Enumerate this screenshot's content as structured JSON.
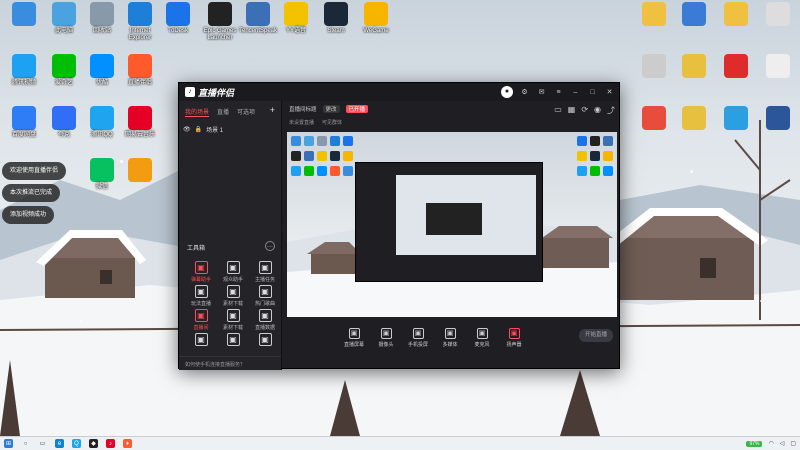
{
  "desktop_icons_left": [
    {
      "label": "",
      "icon": "user-folder-icon",
      "color": "#3a8dde"
    },
    {
      "label": "此电脑",
      "icon": "computer-icon",
      "color": "#4aa3df"
    },
    {
      "label": "回收站",
      "icon": "recycle-bin-icon",
      "color": "#8899aa"
    },
    {
      "label": "Internet Explorer",
      "icon": "ie-icon",
      "color": "#1e7fd8"
    },
    {
      "label": "ToDesk",
      "icon": "todesk-icon",
      "color": "#1a73e8"
    },
    {
      "label": "Epic Games Launcher",
      "icon": "epic-icon",
      "color": "#222222"
    },
    {
      "label": "TencentSpeak",
      "icon": "speak-icon",
      "color": "#3b6fb6"
    },
    {
      "label": "YY语音",
      "icon": "yy-icon",
      "color": "#f2c200"
    },
    {
      "label": "Steam",
      "icon": "steam-icon",
      "color": "#1b2838"
    },
    {
      "label": "WeGame",
      "icon": "wegame-icon",
      "color": "#f7b500"
    },
    {
      "label": "腾讯视频",
      "icon": "tencent-video-icon",
      "color": "#1da1f2"
    },
    {
      "label": "爱奇艺",
      "icon": "iqiyi-icon",
      "color": "#00be06"
    },
    {
      "label": "优酷",
      "icon": "youku-icon",
      "color": "#0090ff"
    },
    {
      "label": "直播伴侣",
      "icon": "companion-icon",
      "color": "#ff5a2b"
    },
    {
      "label": "百度网盘",
      "icon": "baidu-pan-icon",
      "color": "#2e7cf6"
    },
    {
      "label": "夸克",
      "icon": "quark-icon",
      "color": "#2f6ef5"
    },
    {
      "label": "腾讯QQ",
      "icon": "qq-icon",
      "color": "#1ea5f0"
    },
    {
      "label": "网易云音乐",
      "icon": "netease-music-icon",
      "color": "#e60026"
    },
    {
      "label": "微信",
      "icon": "wechat-icon",
      "color": "#07c160"
    },
    {
      "label": "",
      "icon": "game-icon",
      "color": "#f39c12"
    }
  ],
  "desktop_icons_right": [
    {
      "label": "",
      "icon": "folder-icon",
      "color": "#f0c040"
    },
    {
      "label": "",
      "icon": "folder-icon",
      "color": "#3a7bd5"
    },
    {
      "label": "",
      "icon": "folder-icon",
      "color": "#f0c040"
    },
    {
      "label": "",
      "icon": "doc-icon",
      "color": "#dddddd"
    },
    {
      "label": "",
      "icon": "doc-icon",
      "color": "#cccccc"
    },
    {
      "label": "",
      "icon": "folder-icon",
      "color": "#e8c040"
    },
    {
      "label": "",
      "icon": "app-icon",
      "color": "#e02b2b"
    },
    {
      "label": "",
      "icon": "doc-icon",
      "color": "#eeeeee"
    },
    {
      "label": "",
      "icon": "pdf-icon",
      "color": "#e84c3d"
    },
    {
      "label": "",
      "icon": "folder-icon",
      "color": "#e8c040"
    },
    {
      "label": "",
      "icon": "app-icon",
      "color": "#2aa0e0"
    },
    {
      "label": "",
      "icon": "word-icon",
      "color": "#2b579a"
    }
  ],
  "notifications": [
    "欢迎使用直播伴侣",
    "本次推流已完成",
    "添加视频成功"
  ],
  "app": {
    "brand": "直播伴侣",
    "version": "",
    "scene_tabs": [
      "我的场景",
      "直播",
      "可选项"
    ],
    "scene_item": "场景 1",
    "tools_title": "工具箱",
    "tools": [
      {
        "label": "弹幕助手",
        "icon": "barrage-icon",
        "red": true
      },
      {
        "label": "观众助手",
        "icon": "audience-icon",
        "red": false
      },
      {
        "label": "主播任务",
        "icon": "task-icon",
        "red": false
      },
      {
        "label": "玩法直播",
        "icon": "play-icon",
        "red": false
      },
      {
        "label": "素材下载",
        "icon": "download-icon",
        "red": false
      },
      {
        "label": "热门歌曲",
        "icon": "music-icon",
        "red": false
      },
      {
        "label": "直播间",
        "icon": "room-icon",
        "red": true
      },
      {
        "label": "素材下载",
        "icon": "download-icon",
        "red": false
      },
      {
        "label": "直播数据",
        "icon": "data-icon",
        "red": false
      },
      {
        "label": "",
        "icon": "item-icon",
        "red": false
      },
      {
        "label": "",
        "icon": "item-icon",
        "red": false
      },
      {
        "label": "",
        "icon": "item-icon",
        "red": false
      }
    ],
    "bottom_hint": "如何使手机连接直播服务？",
    "topinfo": [
      "直播间标题",
      "更改",
      "已开播"
    ],
    "topinfo2": [
      "未设置直播",
      "可见群体"
    ],
    "controls": [
      {
        "label": "直播屏幕",
        "icon": "screen-icon",
        "red": false
      },
      {
        "label": "摄像头",
        "icon": "camera-icon",
        "red": false
      },
      {
        "label": "手机投屏",
        "icon": "phone-cast-icon",
        "red": false
      },
      {
        "label": "多媒体",
        "icon": "media-icon",
        "red": false
      },
      {
        "label": "麦克风",
        "icon": "mic-icon",
        "red": false
      },
      {
        "label": "扬声器",
        "icon": "speaker-icon",
        "red": true
      }
    ],
    "live_button": "开始直播",
    "status_left": "",
    "status_right": ""
  },
  "taskbar": {
    "battery": "97%"
  }
}
